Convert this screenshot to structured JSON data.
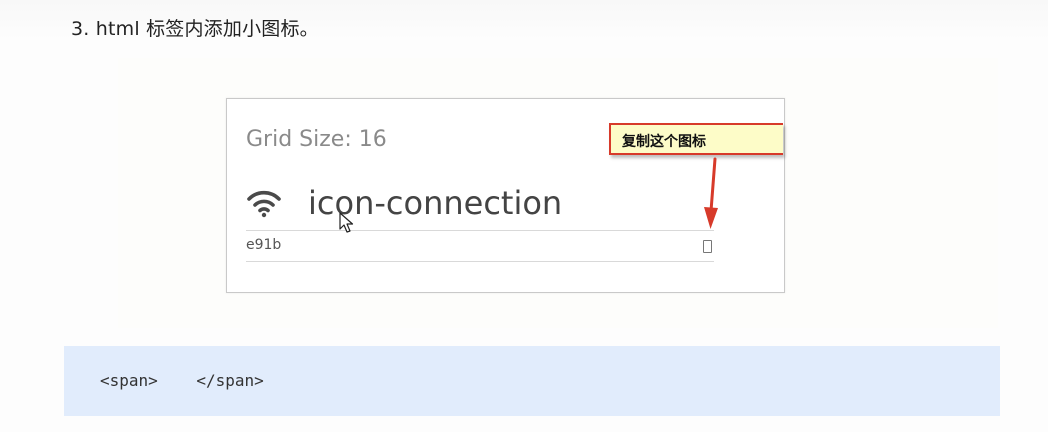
{
  "heading": {
    "text": "3. html 标签内添加小图标。"
  },
  "icon_card": {
    "grid_size_label": "Grid Size: 16",
    "icon_name": "icon-connection",
    "icon_semantic": "wifi-icon",
    "code": "e91b",
    "callout_text": "复制这个图标",
    "callout_border_color": "#d73a2a",
    "callout_background": "#fdfcc8"
  },
  "code_block": {
    "code": "<span>    </span>",
    "background": "#e1ecfc"
  }
}
